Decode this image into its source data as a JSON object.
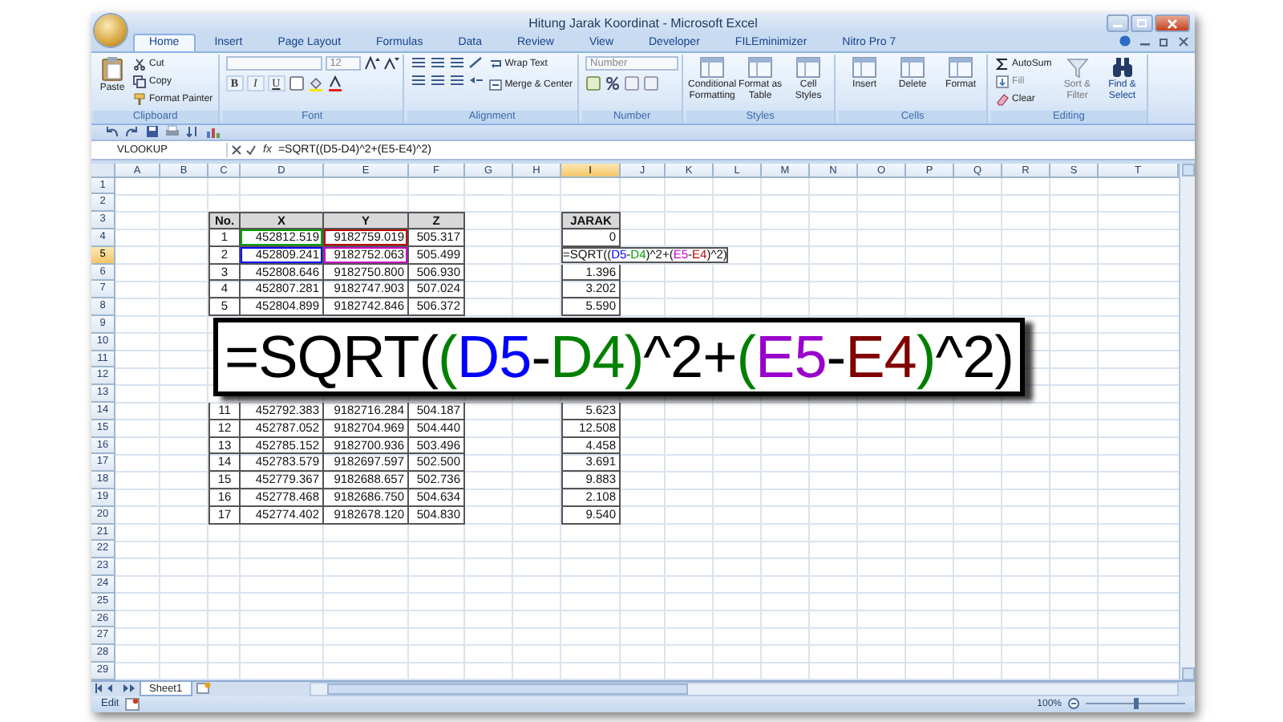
{
  "window": {
    "title": "Hitung Jarak Koordinat - Microsoft Excel"
  },
  "ribbon_tabs": [
    {
      "label": "Home",
      "selected": true
    },
    {
      "label": "Insert",
      "selected": false
    },
    {
      "label": "Page Layout",
      "selected": false
    },
    {
      "label": "Formulas",
      "selected": false
    },
    {
      "label": "Data",
      "selected": false
    },
    {
      "label": "Review",
      "selected": false
    },
    {
      "label": "View",
      "selected": false
    },
    {
      "label": "Developer",
      "selected": false
    },
    {
      "label": "FILEminimizer",
      "selected": false
    },
    {
      "label": "Nitro Pro 7",
      "selected": false
    }
  ],
  "ribbon_groups": [
    {
      "kind": "clipboard",
      "label": "Clipboard",
      "items": [
        "Paste",
        "Cut",
        "Copy",
        "Format Painter"
      ]
    },
    {
      "kind": "font",
      "label": "Font",
      "items": [
        "12",
        "B",
        "I",
        "U"
      ]
    },
    {
      "kind": "alignment",
      "label": "Alignment",
      "items": [
        "Wrap Text",
        "Merge & Center"
      ]
    },
    {
      "kind": "number",
      "label": "Number",
      "items": [
        "Number"
      ]
    },
    {
      "kind": "large",
      "label": "Styles",
      "items": [
        "Conditional Formatting",
        "Format as Table",
        "Cell Styles"
      ]
    },
    {
      "kind": "large",
      "label": "Cells",
      "items": [
        "Insert",
        "Delete",
        "Format"
      ]
    },
    {
      "kind": "editing",
      "label": "Editing",
      "items": [
        "AutoSum",
        "Fill",
        "Clear",
        "Sort & Filter",
        "Find & Select"
      ]
    }
  ],
  "formula_bar": {
    "name_box": "VLOOKUP",
    "fx": "fx",
    "formula": "=SQRT((D5-D4)^2+(E5-E4)^2)"
  },
  "column_headers": [
    {
      "label": "A",
      "selected": false
    },
    {
      "label": "B",
      "selected": false
    },
    {
      "label": "C",
      "selected": false
    },
    {
      "label": "D",
      "selected": false
    },
    {
      "label": "E",
      "selected": false
    },
    {
      "label": "F",
      "selected": false
    },
    {
      "label": "G",
      "selected": false
    },
    {
      "label": "H",
      "selected": false
    },
    {
      "label": "I",
      "selected": true
    },
    {
      "label": "J",
      "selected": false
    },
    {
      "label": "K",
      "selected": false
    },
    {
      "label": "L",
      "selected": false
    },
    {
      "label": "M",
      "selected": false
    },
    {
      "label": "N",
      "selected": false
    },
    {
      "label": "O",
      "selected": false
    },
    {
      "label": "P",
      "selected": false
    },
    {
      "label": "Q",
      "selected": false
    },
    {
      "label": "R",
      "selected": false
    },
    {
      "label": "S",
      "selected": false
    },
    {
      "label": "T",
      "selected": false
    }
  ],
  "row_headers": [
    {
      "label": "1",
      "selected": false
    },
    {
      "label": "2",
      "selected": false
    },
    {
      "label": "3",
      "selected": false
    },
    {
      "label": "4",
      "selected": false
    },
    {
      "label": "5",
      "selected": true
    },
    {
      "label": "6",
      "selected": false
    },
    {
      "label": "7",
      "selected": false
    },
    {
      "label": "8",
      "selected": false
    },
    {
      "label": "9",
      "selected": false
    },
    {
      "label": "10",
      "selected": false
    },
    {
      "label": "11",
      "selected": false
    },
    {
      "label": "12",
      "selected": false
    },
    {
      "label": "13",
      "selected": false
    },
    {
      "label": "14",
      "selected": false
    },
    {
      "label": "15",
      "selected": false
    },
    {
      "label": "16",
      "selected": false
    },
    {
      "label": "17",
      "selected": false
    },
    {
      "label": "18",
      "selected": false
    },
    {
      "label": "19",
      "selected": false
    },
    {
      "label": "20",
      "selected": false
    },
    {
      "label": "21",
      "selected": false
    },
    {
      "label": "22",
      "selected": false
    },
    {
      "label": "23",
      "selected": false
    },
    {
      "label": "24",
      "selected": false
    },
    {
      "label": "25",
      "selected": false
    },
    {
      "label": "26",
      "selected": false
    },
    {
      "label": "27",
      "selected": false
    },
    {
      "label": "28",
      "selected": false
    },
    {
      "label": "29",
      "selected": false
    }
  ],
  "data_table": {
    "columns": [
      "No.",
      "X",
      "Y",
      "Z"
    ],
    "rows": [
      [
        {
          "text": "1"
        },
        {
          "text": "452812.519",
          "color": "#00a000"
        },
        {
          "text": "9182759.019",
          "color": "#c00000"
        },
        {
          "text": "505.317"
        }
      ],
      [
        {
          "text": "2"
        },
        {
          "text": "452809.241",
          "color": "#0000ff"
        },
        {
          "text": "9182752.063",
          "color": "#cc00cc"
        },
        {
          "text": "505.499"
        }
      ],
      [
        {
          "text": "3"
        },
        {
          "text": "452808.646"
        },
        {
          "text": "9182750.800"
        },
        {
          "text": "506.930"
        }
      ],
      [
        {
          "text": "4"
        },
        {
          "text": "452807.281"
        },
        {
          "text": "9182747.903"
        },
        {
          "text": "507.024"
        }
      ],
      [
        {
          "text": "5"
        },
        {
          "text": "452804.899"
        },
        {
          "text": "9182742.846"
        },
        {
          "text": "506.372"
        }
      ],
      null,
      null,
      null,
      null,
      null,
      [
        {
          "text": "11"
        },
        {
          "text": "452792.383"
        },
        {
          "text": "9182716.284"
        },
        {
          "text": "504.187"
        }
      ],
      [
        {
          "text": "12"
        },
        {
          "text": "452787.052"
        },
        {
          "text": "9182704.969"
        },
        {
          "text": "504.440"
        }
      ],
      [
        {
          "text": "13"
        },
        {
          "text": "452785.152"
        },
        {
          "text": "9182700.936"
        },
        {
          "text": "503.496"
        }
      ],
      [
        {
          "text": "14"
        },
        {
          "text": "452783.579"
        },
        {
          "text": "9182697.597"
        },
        {
          "text": "502.500"
        }
      ],
      [
        {
          "text": "15"
        },
        {
          "text": "452779.367"
        },
        {
          "text": "9182688.657"
        },
        {
          "text": "502.736"
        }
      ],
      [
        {
          "text": "16"
        },
        {
          "text": "452778.468"
        },
        {
          "text": "9182686.750"
        },
        {
          "text": "504.634"
        }
      ],
      [
        {
          "text": "17"
        },
        {
          "text": "452774.402"
        },
        {
          "text": "9182678.120"
        },
        {
          "text": "504.830"
        }
      ]
    ]
  },
  "jarak": {
    "header": "JARAK",
    "cells": [
      {
        "kind": "value",
        "text": "0"
      },
      {
        "kind": "editing",
        "segments": [
          {
            "text": "=SQRT(("
          },
          {
            "text": "D5",
            "color": "#0000ff"
          },
          {
            "text": "-"
          },
          {
            "text": "D4",
            "color": "#00a000"
          },
          {
            "text": ")^2+("
          },
          {
            "text": "E5",
            "color": "#cc00cc"
          },
          {
            "text": "-"
          },
          {
            "text": "E4",
            "color": "#c00000"
          },
          {
            "text": ")^2)"
          }
        ]
      },
      {
        "kind": "value",
        "text": "1.396"
      },
      {
        "kind": "value",
        "text": "3.202"
      },
      {
        "kind": "value",
        "text": "5.590"
      },
      null,
      null,
      null,
      null,
      null,
      {
        "kind": "value",
        "text": "5.623"
      },
      {
        "kind": "value",
        "text": "12.508"
      },
      {
        "kind": "value",
        "text": "4.458"
      },
      {
        "kind": "value",
        "text": "3.691"
      },
      {
        "kind": "value",
        "text": "9.883"
      },
      {
        "kind": "value",
        "text": "2.108"
      },
      {
        "kind": "value",
        "text": "9.540"
      }
    ]
  },
  "callout": {
    "segments": [
      {
        "text": "=SQRT(",
        "color": "#000000"
      },
      {
        "text": "(",
        "color": "#008000"
      },
      {
        "text": "D5",
        "color": "#0000ff"
      },
      {
        "text": "-",
        "color": "#000000"
      },
      {
        "text": "D4",
        "color": "#008000"
      },
      {
        "text": ")",
        "color": "#008000"
      },
      {
        "text": "^2+",
        "color": "#000000"
      },
      {
        "text": "(",
        "color": "#008000"
      },
      {
        "text": "E5",
        "color": "#9900cc"
      },
      {
        "text": "-",
        "color": "#000000"
      },
      {
        "text": "E4",
        "color": "#800000"
      },
      {
        "text": ")",
        "color": "#008000"
      },
      {
        "text": "^2)",
        "color": "#000000"
      }
    ]
  },
  "sheet_tabs": [
    {
      "label": "Sheet1",
      "selected": true
    }
  ],
  "status_bar": {
    "mode": "Edit",
    "zoom_text": "100%",
    "zoom": {
      "level": 0.5
    }
  }
}
